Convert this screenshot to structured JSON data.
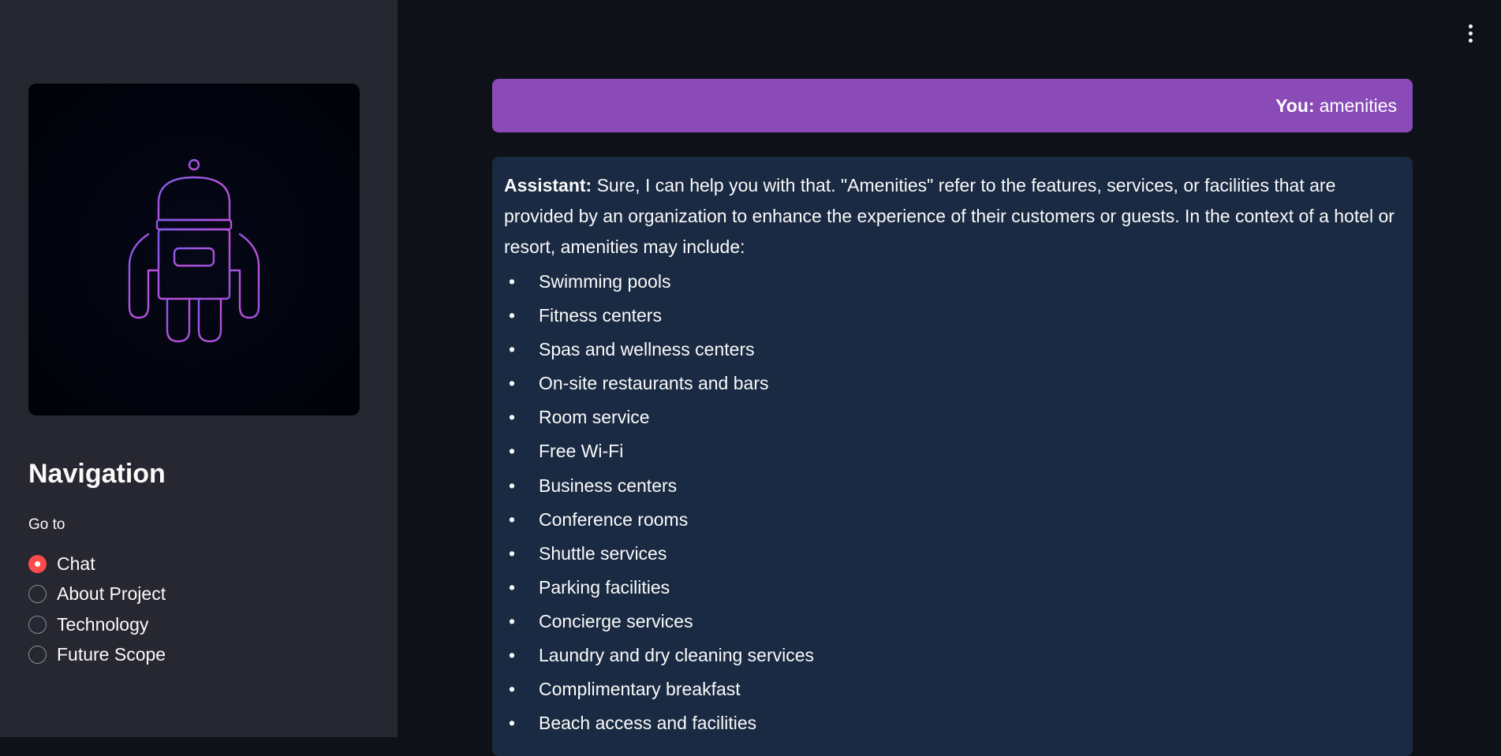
{
  "sidebar": {
    "navigation_title": "Navigation",
    "goto_label": "Go to",
    "options": [
      {
        "label": "Chat",
        "selected": true
      },
      {
        "label": "About Project",
        "selected": false
      },
      {
        "label": "Technology",
        "selected": false
      },
      {
        "label": "Future Scope",
        "selected": false
      }
    ],
    "logo_icon": "robot-icon"
  },
  "header": {
    "menu_icon": "vertical-ellipsis-icon"
  },
  "chat": {
    "user_message": {
      "speaker": "You:",
      "text": "amenities"
    },
    "assistant_message": {
      "speaker": "Assistant:",
      "intro": "Sure, I can help you with that. \"Amenities\" refer to the features, services, or facilities that are provided by an organization to enhance the experience of their customers or guests. In the context of a hotel or resort, amenities may include:",
      "items": [
        "Swimming pools",
        "Fitness centers",
        "Spas and wellness centers",
        "On-site restaurants and bars",
        "Room service",
        "Free Wi-Fi",
        "Business centers",
        "Conference rooms",
        "Shuttle services",
        "Parking facilities",
        "Concierge services",
        "Laundry and dry cleaning services",
        "Complimentary breakfast",
        "Beach access and facilities"
      ]
    }
  },
  "colors": {
    "background": "#0e1117",
    "sidebar": "#262730",
    "user_bubble": "#8a4bb8",
    "assistant_bubble": "#192a42",
    "accent": "#ff4b4b"
  }
}
